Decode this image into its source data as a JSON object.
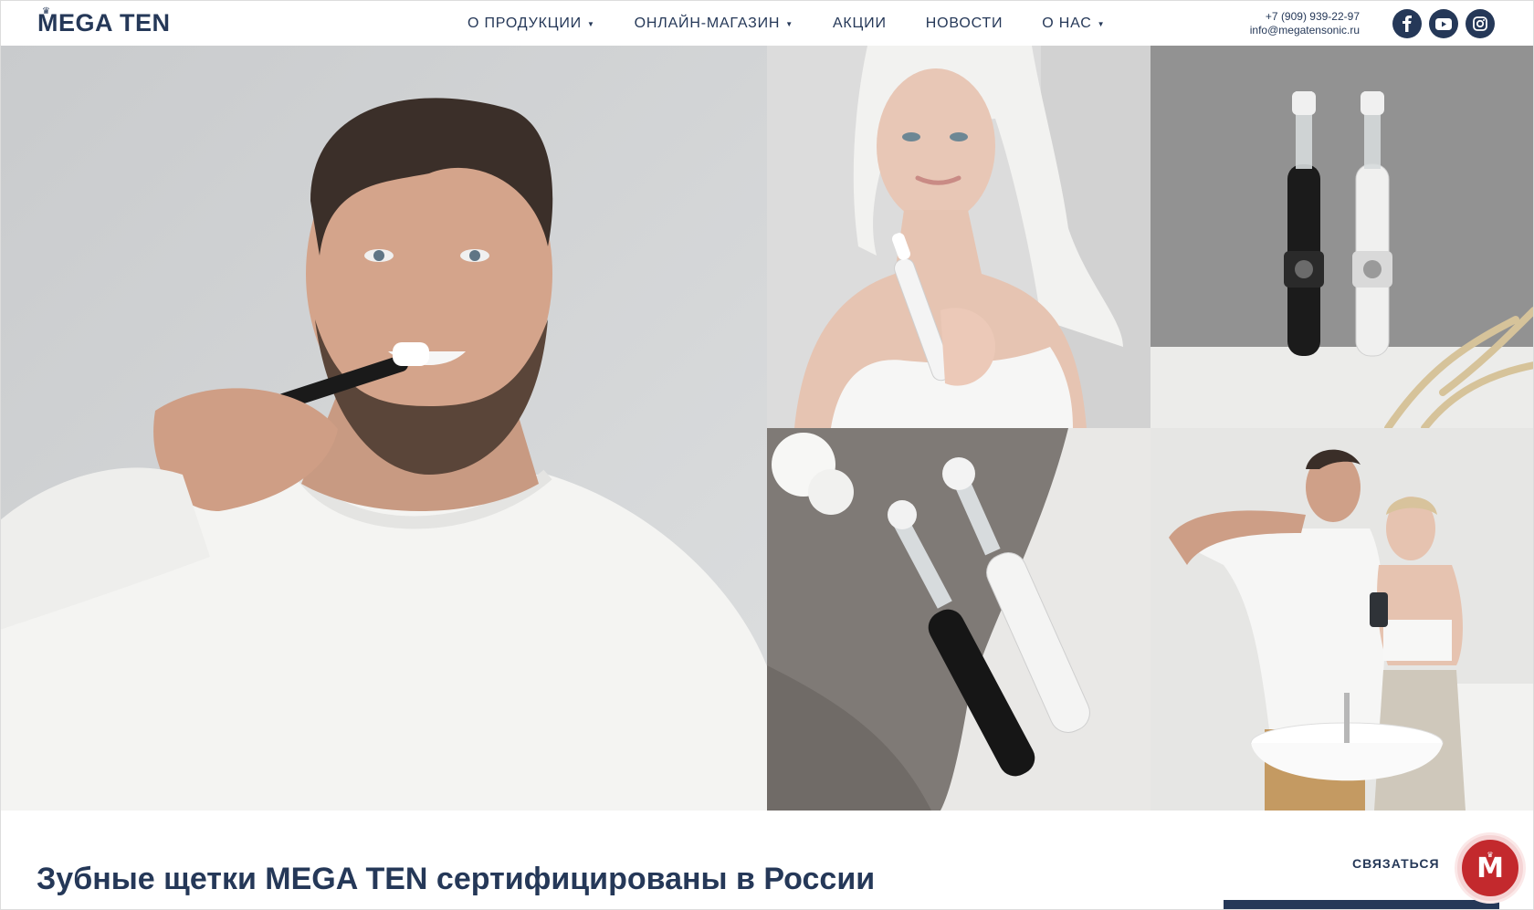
{
  "header": {
    "logo_text": "MEGA TEN",
    "nav": [
      {
        "label": "О ПРОДУКЦИИ",
        "has_dropdown": true
      },
      {
        "label": "ОНЛАЙН-МАГАЗИН",
        "has_dropdown": true
      },
      {
        "label": "АКЦИИ",
        "has_dropdown": false
      },
      {
        "label": "НОВОСТИ",
        "has_dropdown": false
      },
      {
        "label": "О НАС",
        "has_dropdown": true
      }
    ],
    "phone": "+7 (909) 939-22-97",
    "email": "info@megatensonic.ru",
    "social": [
      {
        "icon": "facebook-icon",
        "glyph": "f"
      },
      {
        "icon": "youtube-icon",
        "glyph": "▶"
      },
      {
        "icon": "instagram-icon",
        "glyph": "◎"
      }
    ]
  },
  "gallery": {
    "photos": [
      {
        "icon": "photo-man-brushing-teeth"
      },
      {
        "icon": "photo-woman-with-toothbrush"
      },
      {
        "icon": "photo-black-white-toothbrushes"
      },
      {
        "icon": "photo-toothbrushes-on-towel"
      },
      {
        "icon": "photo-couple-brushing-teeth"
      }
    ]
  },
  "main": {
    "headline": "Зубные щетки MEGA TEN сертифицированы в России",
    "contact_link": "СВЯЗАТЬСЯ",
    "chat_button_letter": "M"
  },
  "colors": {
    "brand": "#253858",
    "accent_red": "#c3292d"
  }
}
